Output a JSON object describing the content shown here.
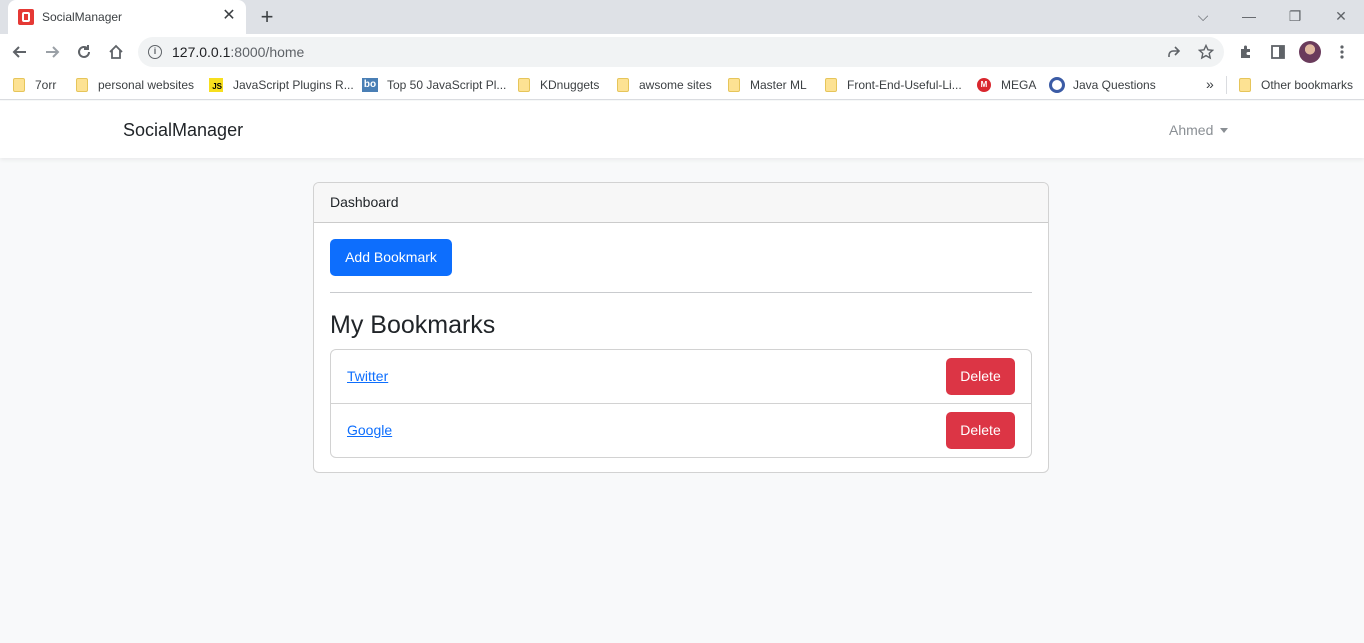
{
  "browser": {
    "tab_title": "SocialManager",
    "tab_close": "✕",
    "new_tab": "+",
    "url_host": "127.0.0.1",
    "url_path": ":8000/home",
    "window_controls": [
      "⌵",
      "—",
      "❐",
      "✕"
    ]
  },
  "bookmarks_bar": {
    "items": [
      {
        "label": "7orr",
        "icon": "folder-icon"
      },
      {
        "label": "personal websites",
        "icon": "folder-icon"
      },
      {
        "label": "JavaScript Plugins R...",
        "icon": "js-icon"
      },
      {
        "label": "Top 50 JavaScript Pl...",
        "icon": "bo-icon"
      },
      {
        "label": "KDnuggets",
        "icon": "folder-icon"
      },
      {
        "label": "awsome sites",
        "icon": "folder-icon"
      },
      {
        "label": "Master ML",
        "icon": "folder-icon"
      },
      {
        "label": "Front-End-Useful-Li...",
        "icon": "folder-icon"
      },
      {
        "label": "MEGA",
        "icon": "mega-icon"
      },
      {
        "label": "Java Questions",
        "icon": "q-icon"
      }
    ],
    "more": "»",
    "other_bookmarks": "Other bookmarks"
  },
  "navbar": {
    "brand": "SocialManager",
    "user": "Ahmed"
  },
  "dashboard": {
    "header": "Dashboard",
    "add_button": "Add Bookmark",
    "section_title": "My Bookmarks",
    "bookmarks": [
      {
        "name": "Twitter",
        "delete_label": "Delete"
      },
      {
        "name": "Google",
        "delete_label": "Delete"
      }
    ]
  },
  "colors": {
    "primary": "#0d6efd",
    "danger": "#dc3545",
    "page_bg": "#f8f9fa"
  }
}
